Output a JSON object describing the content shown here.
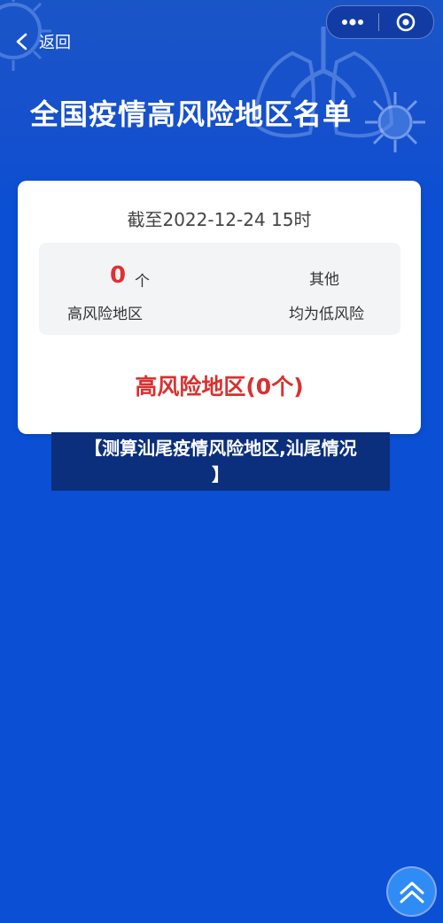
{
  "nav": {
    "back_label": "返回"
  },
  "header": {
    "title": "全国疫情高风险地区名单"
  },
  "summary": {
    "as_of": "截至2022-12-24 15时",
    "high_risk_count": "0",
    "count_unit": "个",
    "high_risk_label": "高风险地区",
    "other_label": "其他",
    "other_desc": "均为低风险"
  },
  "high_risk_section": {
    "title": "高风险地区(0个)"
  },
  "banner": {
    "line1": "【测算汕尾疫情风险地区,汕尾情况",
    "line2": "】"
  },
  "icons": {
    "back": "chevron-left-icon",
    "more": "more-dots-icon",
    "close": "target-close-icon",
    "scroll_top": "double-chevron-up-icon"
  },
  "colors": {
    "background": "#0a4fd4",
    "accent_red": "#e03131",
    "banner_bg": "#0b2f7c",
    "scroll_button": "#2f8cf5"
  }
}
